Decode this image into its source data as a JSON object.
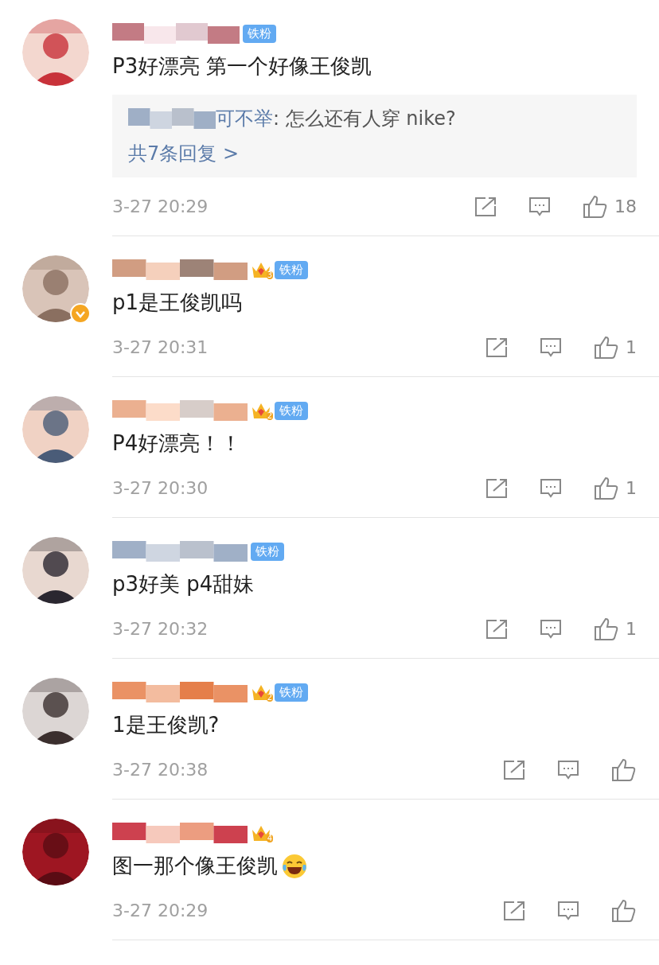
{
  "comments": [
    {
      "badge": "铁粉",
      "text": "P3好漂亮 第一个好像王俊凯",
      "reply": {
        "author": "可不举",
        "text": ": 怎么还有人穿 nike?",
        "more": "共7条回复 >"
      },
      "time": "3-27 20:29",
      "likes": "18"
    },
    {
      "crown": "3",
      "badge": "铁粉",
      "text": "p1是王俊凯吗",
      "time": "3-27 20:31",
      "likes": "1",
      "verified": true
    },
    {
      "crown": "2",
      "badge": "铁粉",
      "text": "P4好漂亮！！",
      "time": "3-27 20:30",
      "likes": "1"
    },
    {
      "badge": "铁粉",
      "text": "p3好美 p4甜妹",
      "time": "3-27 20:32",
      "likes": "1"
    },
    {
      "crown": "2",
      "badge": "铁粉",
      "text": "1是王俊凯?",
      "time": "3-27 20:38"
    },
    {
      "crown": "4",
      "text": "图一那个像王俊凯",
      "emoji": true,
      "time": "3-27 20:29"
    }
  ]
}
